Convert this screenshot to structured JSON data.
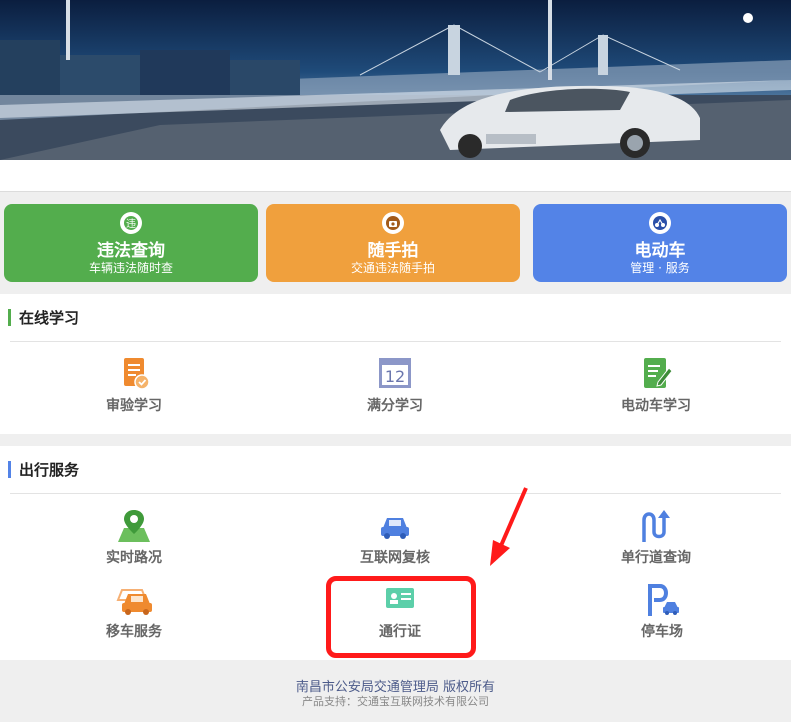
{
  "tiles": [
    {
      "title": "违法查询",
      "subtitle": "车辆违法随时查",
      "icon": "violation-icon",
      "color": "#53ad4d"
    },
    {
      "title": "随手拍",
      "subtitle": "交通违法随手拍",
      "icon": "camera-icon",
      "color": "#f0a03d"
    },
    {
      "title": "电动车",
      "subtitle": "管理 · 服务",
      "icon": "scooter-icon",
      "color": "#5383e7"
    }
  ],
  "study": {
    "title": "在线学习",
    "accent": "#53ad4d",
    "items": [
      {
        "label": "审验学习",
        "icon": "audit-document-icon"
      },
      {
        "label": "满分学习",
        "icon": "calendar-12-icon",
        "calendar_number": "12"
      },
      {
        "label": "电动车学习",
        "icon": "edit-document-icon"
      }
    ]
  },
  "travel": {
    "title": "出行服务",
    "accent": "#5383e7",
    "items": [
      {
        "label": "实时路况",
        "icon": "map-pin-icon"
      },
      {
        "label": "互联网复核",
        "icon": "car-icon"
      },
      {
        "label": "单行道查询",
        "icon": "one-way-icon"
      },
      {
        "label": "移车服务",
        "icon": "move-car-icon"
      },
      {
        "label": "通行证",
        "icon": "pass-card-icon"
      },
      {
        "label": "停车场",
        "icon": "parking-icon"
      }
    ]
  },
  "footer": {
    "copyright": "南昌市公安局交通管理局  版权所有",
    "support": "产品支持：交通宝互联网技术有限公司"
  }
}
